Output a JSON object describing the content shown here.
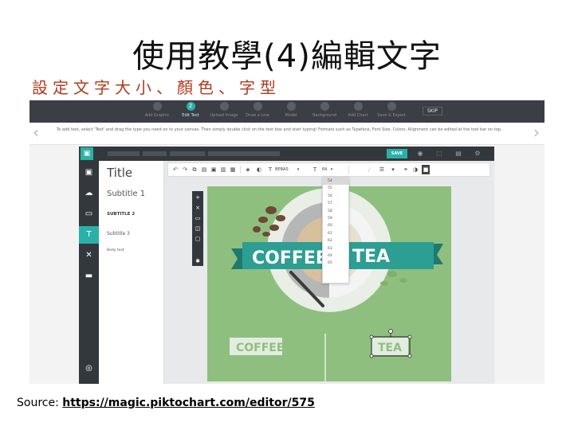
{
  "slide": {
    "title": "使用教學(4)編輯文字",
    "subtitle": "設定文字大小、顏色、字型",
    "source_label": "Source: ",
    "source_url": "https://magic.piktochart.com/editor/575"
  },
  "wizard": {
    "steps": [
      {
        "num": "",
        "label": "Add Graphic"
      },
      {
        "num": "2",
        "label": "Edit Text",
        "active": true
      },
      {
        "num": "",
        "label": "Upload Image"
      },
      {
        "num": "",
        "label": "Draw a Line"
      },
      {
        "num": "",
        "label": "Model"
      },
      {
        "num": "",
        "label": "Background"
      },
      {
        "num": "",
        "label": "Add Chart"
      },
      {
        "num": "",
        "label": "Save & Export"
      }
    ],
    "skip_label": "SKIP"
  },
  "instruction": "To add text, select 'Text' and drag the type you need on to your canvas. Then simply double click on the text box and start typing! Formats such as Typeface, Font Size, Colors, Alignment can be edited at the tool bar on top.",
  "editor": {
    "save_label": "SAVE",
    "text_panel": {
      "title": "Title",
      "subtitle1": "Subtitle 1",
      "subtitle2": "SUBTITLE 2",
      "subtitle3": "Subtitle 3",
      "body": "Body text"
    },
    "format_bar": {
      "font_name": "BEBAS",
      "font_size": "64"
    },
    "font_sizes": [
      "54",
      "55",
      "56",
      "57",
      "58",
      "59",
      "60",
      "61",
      "62",
      "63",
      "64",
      "65"
    ],
    "selected_font_size": "64"
  },
  "canvas": {
    "banner_left": "COFFEE",
    "banner_right": "TEA",
    "label_coffee": "COFFEE",
    "label_tea": "TEA"
  },
  "colors": {
    "accent": "#2ab1a7",
    "dark": "#33383d",
    "canvas_green": "#8fbf7f",
    "banner_teal": "#2c9e92",
    "subtitle_red": "#b03a1d"
  }
}
